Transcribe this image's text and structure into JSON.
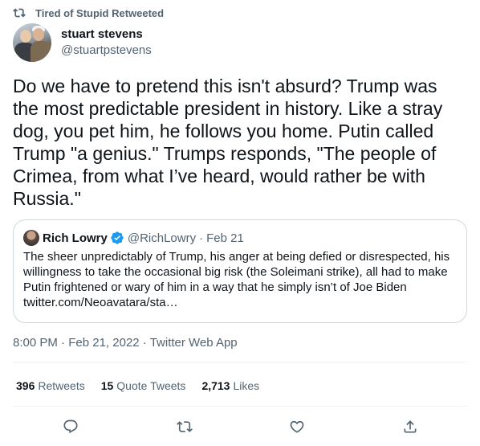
{
  "social_context": {
    "text": "Tired of Stupid Retweeted",
    "icon": "retweet-icon"
  },
  "author": {
    "display_name": "stuart stevens",
    "handle": "@stuartpstevens"
  },
  "tweet": {
    "text": "Do we have to pretend this isn't absurd? Trump was\nthe most predictable president in history. Like a stray\ndog, you pet him, he follows you home. Putin called\nTrump \"a genius.\" Trumps responds, \"The people of\nCrimea, from what I’ve heard, would rather be with\nRussia.\""
  },
  "quote": {
    "display_name": "Rich Lowry",
    "verified_icon": "verified-badge-icon",
    "handle": "@RichLowry",
    "separator": "·",
    "date": "Feb 21",
    "text": "The sheer unpredictably of Trump, his anger at being defied or disrespected, his\nwillingness to take the occasional big risk (the Soleimani strike), all had to make\nPutin frightened or wary of him in a way that he simply isn’t of Joe Biden\ntwitter.com/Neoavatara/sta…"
  },
  "meta": {
    "time": "8:00 PM",
    "sep1": " · ",
    "date": "Feb 21, 2022",
    "sep2": " · ",
    "source": "Twitter Web App"
  },
  "stats": [
    {
      "count": "396",
      "label": "Retweets"
    },
    {
      "count": "15",
      "label": "Quote Tweets"
    },
    {
      "count": "2,713",
      "label": "Likes"
    }
  ],
  "actions": [
    "reply-icon",
    "retweet-icon",
    "like-icon",
    "share-icon"
  ],
  "colors": {
    "text_primary": "#0f1419",
    "text_secondary": "#536471",
    "verified_blue": "#1d9bf0",
    "border": "#cfd9de"
  }
}
